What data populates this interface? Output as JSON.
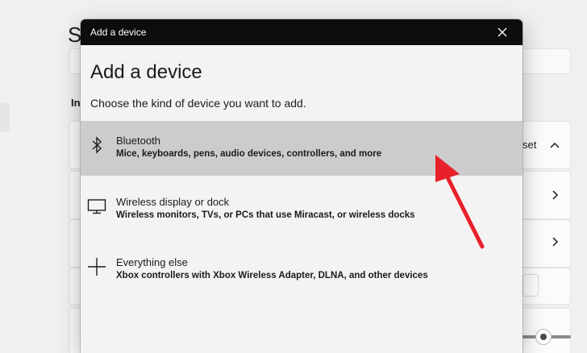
{
  "background": {
    "title": "S",
    "section_label": "In",
    "reset_text": "set"
  },
  "dialog": {
    "titlebar": "Add a device",
    "heading": "Add a device",
    "subheading": "Choose the kind of device you want to add.",
    "options": [
      {
        "title": "Bluetooth",
        "description": "Mice, keyboards, pens, audio devices, controllers, and more",
        "icon": "bluetooth-icon",
        "selected": true
      },
      {
        "title": "Wireless display or dock",
        "description": "Wireless monitors, TVs, or PCs that use Miracast, or wireless docks",
        "icon": "monitor-icon",
        "selected": false
      },
      {
        "title": "Everything else",
        "description": "Xbox controllers with Xbox Wireless Adapter, DLNA, and other devices",
        "icon": "plus-icon",
        "selected": false
      }
    ]
  },
  "colors": {
    "titlebar": "#0d0d0d",
    "selected_row": "#cccccc",
    "dialog_bg": "#f3f3f3",
    "annotation_arrow": "#e8202a"
  }
}
